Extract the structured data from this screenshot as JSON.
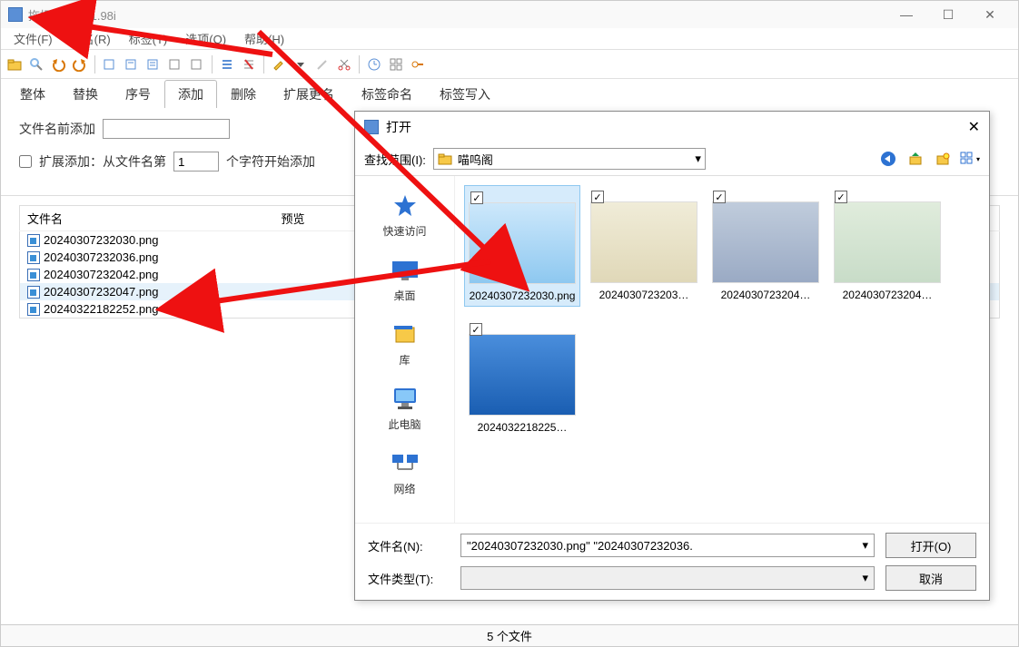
{
  "window": {
    "title": "拖把更名器 1.98i"
  },
  "menubar": [
    "文件(F)",
    "更名(R)",
    "标签(T)",
    "选项(O)",
    "帮助(H)"
  ],
  "tabs": [
    "整体",
    "替换",
    "序号",
    "添加",
    "删除",
    "扩展更名",
    "标签命名",
    "标签写入"
  ],
  "active_tab": 3,
  "form": {
    "prefix_label": "文件名前添加",
    "prefix_value": "",
    "suffix_label_partial": "文件",
    "ext_label": "扩展添加：从文件名第",
    "ext_num": "1",
    "ext_tail": "个字符开始添加"
  },
  "table": {
    "headers": [
      "文件名",
      "预览"
    ],
    "rows": [
      "20240307232030.png",
      "20240307232036.png",
      "20240307232042.png",
      "20240307232047.png",
      "20240322182252.png"
    ],
    "selected_index": 3
  },
  "statusbar": "5 个文件",
  "dialog": {
    "title": "打开",
    "lookin_label": "查找范围(I):",
    "lookin_value": "喵呜阁",
    "side": [
      "快速访问",
      "桌面",
      "库",
      "此电脑",
      "网络"
    ],
    "thumbs": [
      {
        "name": "20240307232030.png",
        "color": "#8ec8f0",
        "selected": true
      },
      {
        "name": "2024030723203…",
        "color": "#e8e0cc",
        "selected": false
      },
      {
        "name": "2024030723204…",
        "color": "#a8b8d0",
        "selected": false
      },
      {
        "name": "2024030723204…",
        "color": "#cfe0d0",
        "selected": false
      },
      {
        "name": "2024032218225…",
        "color": "#2d72d2",
        "selected": false
      }
    ],
    "filename_label": "文件名(N):",
    "filename_value": "\"20240307232030.png\" \"20240307232036.",
    "filetype_label": "文件类型(T):",
    "filetype_value": "",
    "open_btn": "打开(O)",
    "cancel_btn": "取消"
  }
}
